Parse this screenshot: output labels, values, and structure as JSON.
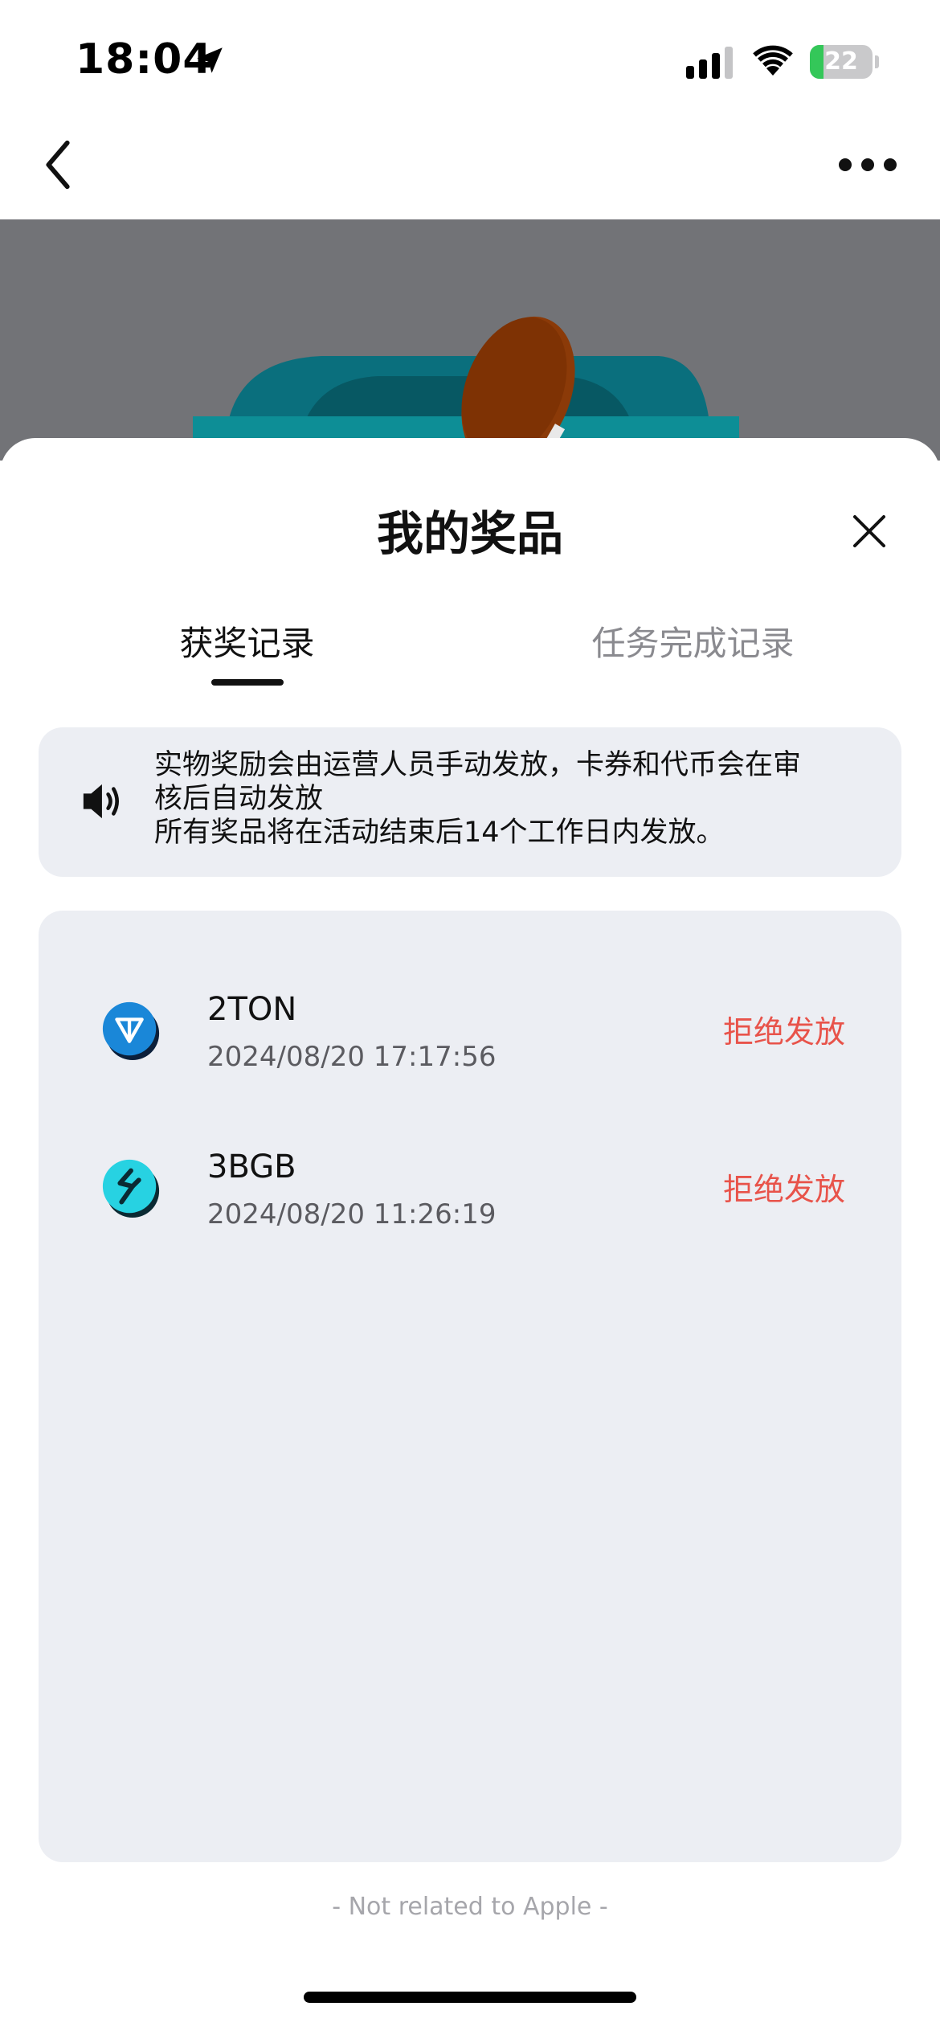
{
  "status_bar": {
    "time": "18:04",
    "battery_level": "22",
    "icons": [
      "location-arrow-icon",
      "cellular-signal-icon",
      "wifi-icon",
      "battery-charging-icon"
    ]
  },
  "nav": {
    "back_icon": "chevron-left-icon",
    "more_icon": "ellipsis-icon"
  },
  "sheet": {
    "title": "我的奖品",
    "close_icon": "close-icon",
    "tabs": [
      {
        "label": "获奖记录",
        "active": true
      },
      {
        "label": "任务完成记录",
        "active": false
      }
    ],
    "notice": {
      "icon": "speaker-icon",
      "lines": [
        "实物奖励会由运营人员手动发放，卡券和代币会在审",
        "核后自动发放",
        "所有奖品将在活动结束后14个工作日内发放。"
      ]
    },
    "prizes": [
      {
        "name": "2TON",
        "date": "2024/08/20 17:17:56",
        "status": "拒绝发放",
        "icon": "ton-coin-icon"
      },
      {
        "name": "3BGB",
        "date": "2024/08/20 11:26:19",
        "status": "拒绝发放",
        "icon": "bgb-coin-icon"
      }
    ],
    "footer_note": "- Not related to Apple -"
  },
  "colors": {
    "accent_red": "#e8534a",
    "panel_bg": "#eceef3",
    "banner_bg": "#727377",
    "battery_green": "#34c759"
  }
}
